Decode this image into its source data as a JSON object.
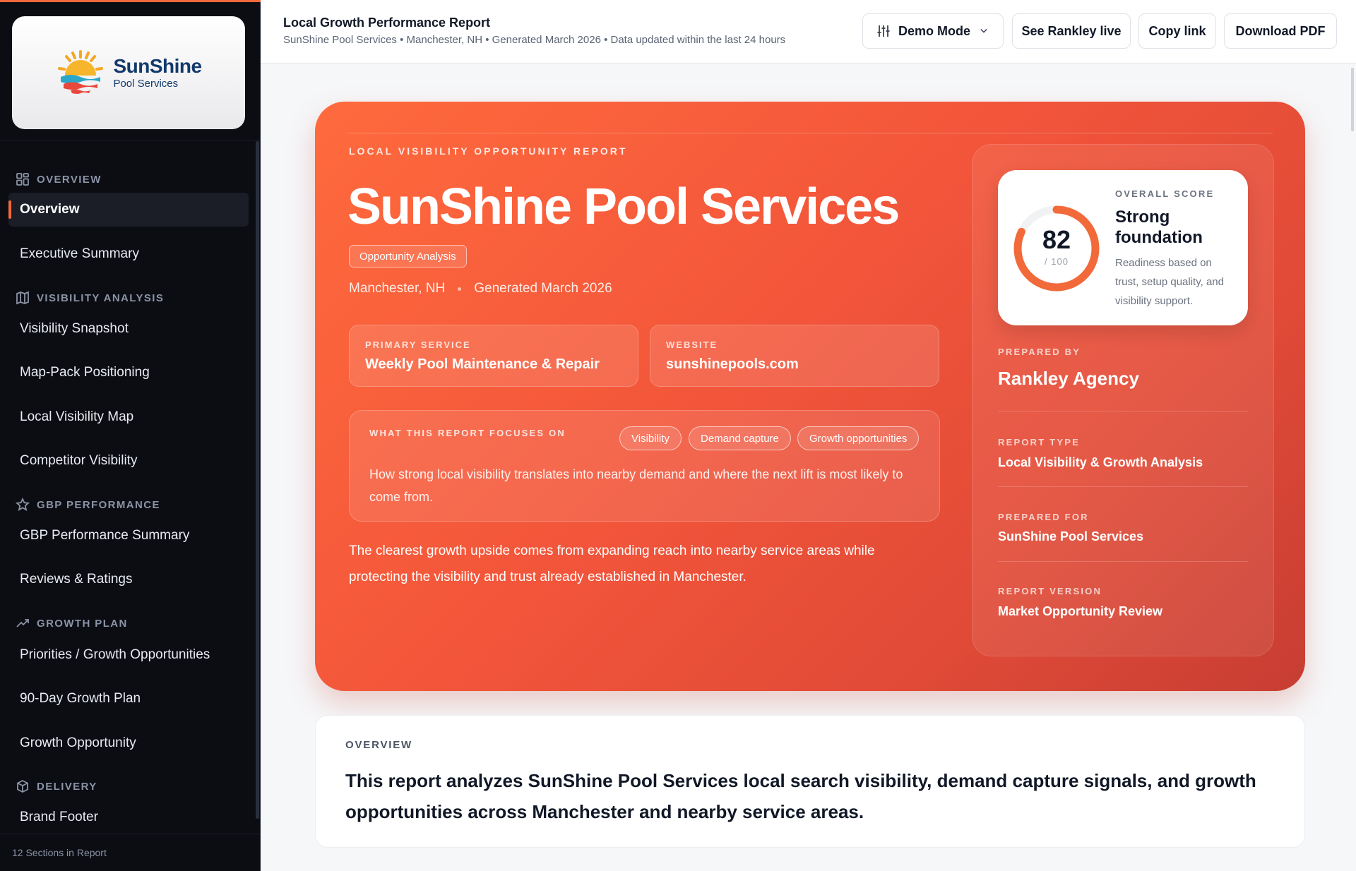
{
  "brand": {
    "name": "SunShine",
    "sub": "Pool Services"
  },
  "sidebar": {
    "groups": [
      {
        "label": "OVERVIEW",
        "items": [
          "Overview",
          "Executive Summary"
        ]
      },
      {
        "label": "VISIBILITY ANALYSIS",
        "items": [
          "Visibility Snapshot",
          "Map-Pack Positioning",
          "Local Visibility Map",
          "Competitor Visibility"
        ]
      },
      {
        "label": "GBP PERFORMANCE",
        "items": [
          "GBP Performance Summary",
          "Reviews & Ratings"
        ]
      },
      {
        "label": "GROWTH PLAN",
        "items": [
          "Priorities / Growth Opportunities",
          "90-Day Growth Plan",
          "Growth Opportunity"
        ]
      },
      {
        "label": "DELIVERY",
        "items": [
          "Brand Footer"
        ]
      }
    ],
    "active_item": "Overview",
    "footer": "12 Sections in Report"
  },
  "header": {
    "title": "Local Growth Performance Report",
    "subtitle": "SunShine Pool Services • Manchester, NH • Generated March 2026 • Data updated within the last 24 hours",
    "mode_label": "Demo Mode",
    "live_label": "See Rankley live",
    "copy_label": "Copy link",
    "pdf_label": "Download PDF"
  },
  "hero": {
    "eyebrow": "LOCAL VISIBILITY OPPORTUNITY REPORT",
    "title": "SunShine Pool Services",
    "badge": "Opportunity Analysis",
    "location": "Manchester, NH",
    "generated": "Generated March 2026",
    "primary_service_label": "PRIMARY SERVICE",
    "primary_service": "Weekly Pool Maintenance & Repair",
    "website_label": "WEBSITE",
    "website": "sunshinepools.com",
    "focus_label": "WHAT THIS REPORT FOCUSES ON",
    "focus_tags": [
      "Visibility",
      "Demand capture",
      "Growth opportunities"
    ],
    "focus_text": "How strong local visibility translates into nearby demand and where the next lift is most likely to come from.",
    "summary": "The clearest growth upside comes from expanding reach into nearby service areas while protecting the visibility and trust already established in Manchester."
  },
  "score": {
    "label": "OVERALL SCORE",
    "value": 82,
    "max": 100,
    "max_text": "/ 100",
    "headline": "Strong foundation",
    "description": "Readiness based on trust, setup quality, and visibility support.",
    "accent": "#f26a3a"
  },
  "panel": {
    "prepared_by_label": "PREPARED BY",
    "prepared_by": "Rankley Agency",
    "report_type_label": "REPORT TYPE",
    "report_type": "Local Visibility & Growth Analysis",
    "prepared_for_label": "PREPARED FOR",
    "prepared_for": "SunShine Pool Services",
    "version_label": "REPORT VERSION",
    "version": "Market Opportunity Review"
  },
  "overview": {
    "label": "OVERVIEW",
    "text": "This report analyzes SunShine Pool Services local search visibility, demand capture signals, and growth opportunities across Manchester and nearby service areas."
  }
}
